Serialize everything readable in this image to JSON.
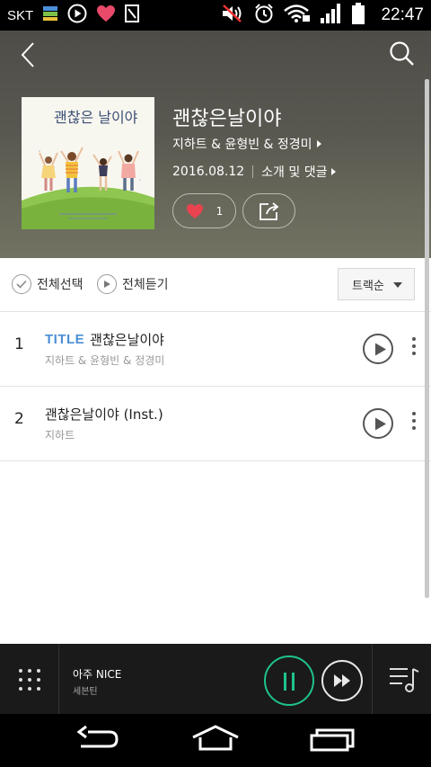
{
  "status_bar": {
    "carrier": "SKT",
    "time": "22:47"
  },
  "album": {
    "title": "괜찮은날이야",
    "artists": "지하트 & 윤형빈 & 정경미",
    "release_date": "2016.08.12",
    "info_link": "소개 및 댓글",
    "like_count": "1",
    "cover_lettering": "괜찮은 날이야"
  },
  "toolbar": {
    "select_all": "전체선택",
    "play_all": "전체듣기",
    "sort": "트랙순"
  },
  "tracks": [
    {
      "no": "1",
      "badge": "TITLE",
      "title": "괜찮은날이야",
      "artist": "지하트 & 윤형빈 & 정경미"
    },
    {
      "no": "2",
      "badge": "",
      "title": "괜찮은날이야 (Inst.)",
      "artist": "지하트"
    }
  ],
  "mini_player": {
    "title": "아주 NICE",
    "artist": "세븐틴"
  },
  "colors": {
    "accent_green": "#1ec38c",
    "title_badge_blue": "#4a8fd3",
    "heart_red": "#e8434f"
  }
}
